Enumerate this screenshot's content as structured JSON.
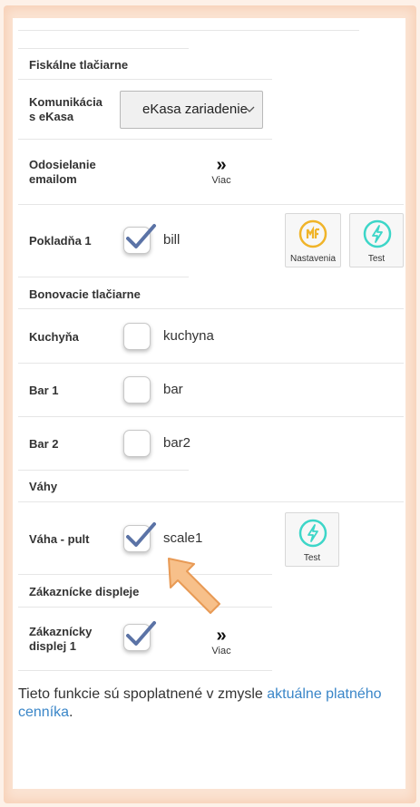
{
  "sections": {
    "fiscal": "Fiskálne tlačiarne",
    "receipt": "Bonovacie tlačiarne",
    "scales": "Váhy",
    "displays": "Zákaznícke displeje"
  },
  "fiscal": {
    "ekasa_label": "Komunikácia s eKasa",
    "ekasa_value": "eKasa zariadenie",
    "email_label": "Odosielanie emailom",
    "more_label": "Viac",
    "more_arrows": "»",
    "pokladna_label": "Pokladňa 1",
    "pokladna_device": "bill",
    "pokladna_checked": true,
    "settings_label": "Nastavenia",
    "test_label": "Test"
  },
  "receipt_printers": [
    {
      "label": "Kuchyňa",
      "device": "kuchyna",
      "checked": false
    },
    {
      "label": "Bar 1",
      "device": "bar",
      "checked": false
    },
    {
      "label": "Bar 2",
      "device": "bar2",
      "checked": false
    }
  ],
  "scales": {
    "label": "Váha - pult",
    "device": "scale1",
    "checked": true,
    "test_label": "Test"
  },
  "displays": {
    "label": "Zákaznícky displej 1",
    "checked": true,
    "more_label": "Viac",
    "more_arrows": "»"
  },
  "footer": {
    "text": "Tieto funkcie sú spoplatnené v zmysle ",
    "link": "aktuálne platného cenníka",
    "end": "."
  },
  "colors": {
    "accent_link": "#3a86c8",
    "check": "#5b73a6",
    "settings_icon": "#f0b429",
    "test_icon": "#3dd6c8",
    "pointer_arrow": "#f7c08a"
  }
}
